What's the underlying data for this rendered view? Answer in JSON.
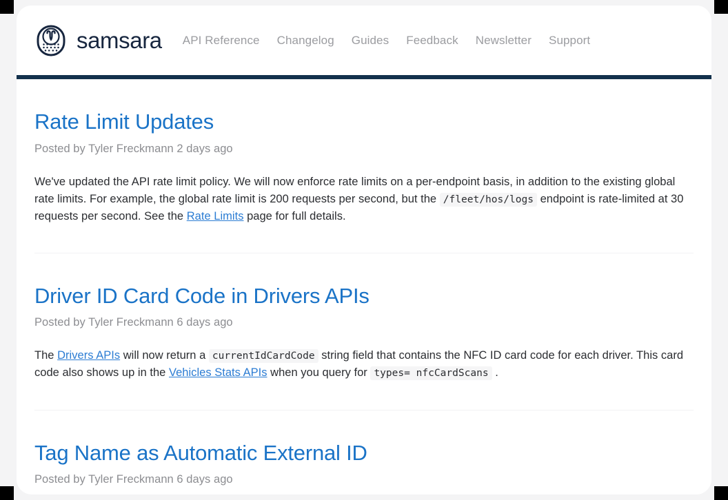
{
  "header": {
    "brand": {
      "icon": "samsara-owl-logo-icon",
      "wordmark": "samsara"
    },
    "nav": [
      {
        "label": "API Reference"
      },
      {
        "label": "Changelog"
      },
      {
        "label": "Guides"
      },
      {
        "label": "Feedback"
      },
      {
        "label": "Newsletter"
      },
      {
        "label": "Support"
      }
    ],
    "rule_color": "#13314c"
  },
  "colors": {
    "heading_link": "#1a73c7",
    "body_link": "#2b7cd3",
    "brand_navy": "#17263f",
    "meta_gray": "#8c8d91",
    "nav_gray": "#9b9ca0",
    "code_bg": "#f5f5f6",
    "divider": "#f2f2f4",
    "page_bg": "#f4f4f5"
  },
  "posts": [
    {
      "title": "Rate Limit Updates",
      "meta": "Posted by Tyler Freckmann 2 days ago",
      "body": [
        {
          "type": "text",
          "value": "We've updated the API rate limit policy. We will now enforce rate limits on a per-endpoint basis, in addition to the existing global rate limits. For example, the global rate limit is 200 requests per second, but the "
        },
        {
          "type": "code",
          "value": "/fleet/hos/logs"
        },
        {
          "type": "text",
          "value": " endpoint is rate-limited at 30 requests per second. See the "
        },
        {
          "type": "link",
          "value": "Rate Limits"
        },
        {
          "type": "text",
          "value": " page for full details."
        }
      ]
    },
    {
      "title": "Driver ID Card Code in Drivers APIs",
      "meta": "Posted by Tyler Freckmann 6 days ago",
      "body": [
        {
          "type": "text",
          "value": "The "
        },
        {
          "type": "link",
          "value": "Drivers APIs"
        },
        {
          "type": "text",
          "value": " will now return a "
        },
        {
          "type": "code",
          "value": "currentIdCardCode"
        },
        {
          "type": "text",
          "value": " string field that contains the NFC ID card code for each driver. This card code also shows up in the "
        },
        {
          "type": "link",
          "value": "Vehicles Stats APIs"
        },
        {
          "type": "text",
          "value": " when you query for "
        },
        {
          "type": "code",
          "value": "types= nfcCardScans"
        },
        {
          "type": "text",
          "value": " ."
        }
      ]
    },
    {
      "title": "Tag Name as Automatic External ID",
      "meta": "Posted by Tyler Freckmann 6 days ago",
      "body": []
    }
  ]
}
